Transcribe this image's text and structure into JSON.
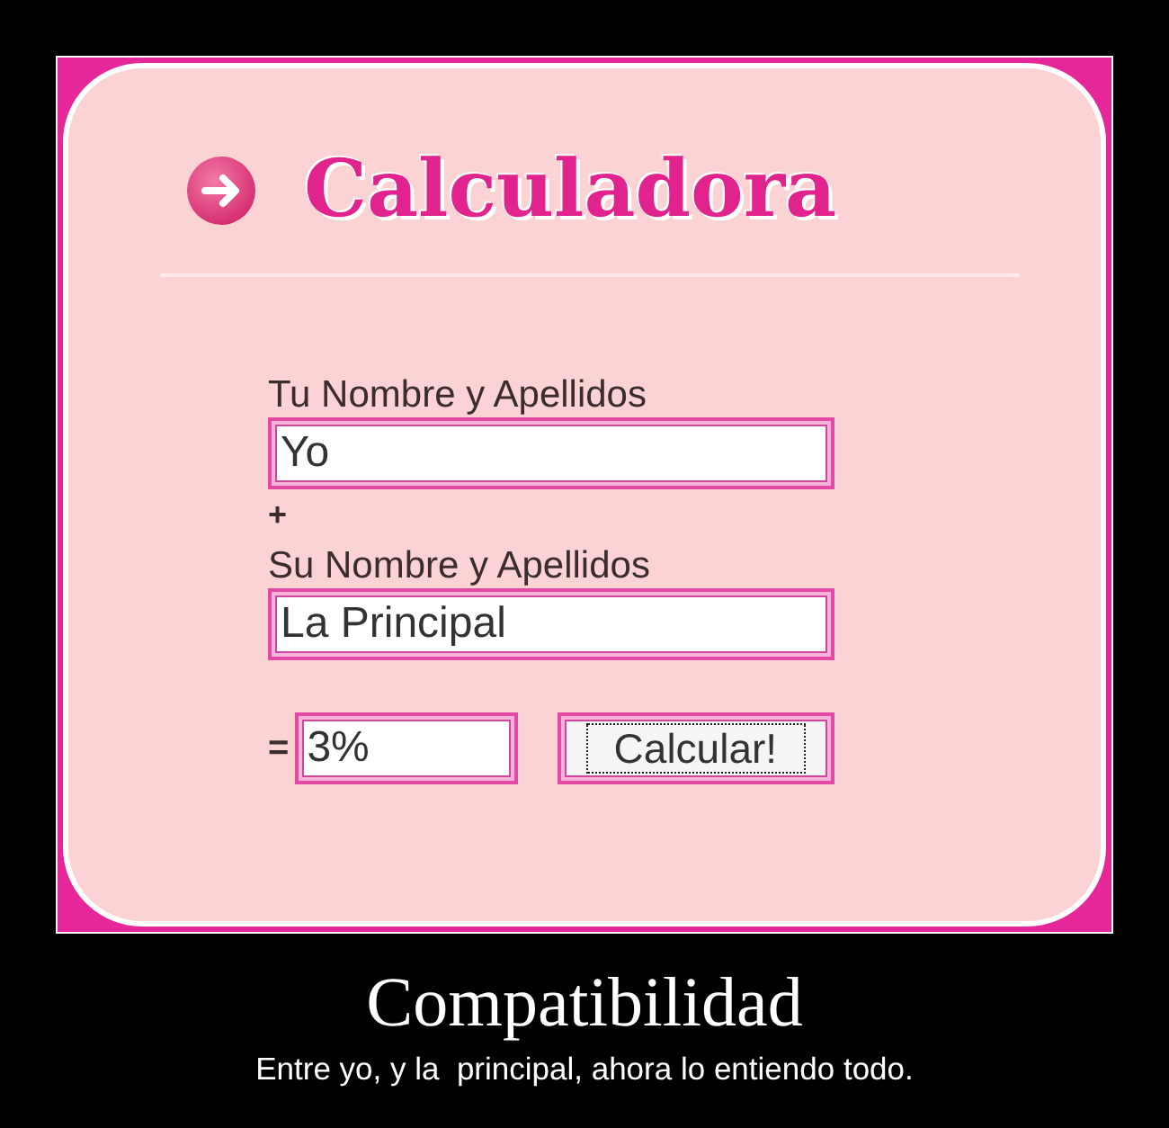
{
  "calculator": {
    "heading": "Calculadora",
    "first_name": {
      "label": "Tu Nombre y Apellidos",
      "value": "Yo"
    },
    "operator": "+",
    "second_name": {
      "label": "Su Nombre y Apellidos",
      "value": "La Principal"
    },
    "equals": "=",
    "result": {
      "value": "3%"
    },
    "button": {
      "label": "Calcular!",
      "focused": true
    }
  },
  "poster": {
    "title": "Compatibilidad",
    "caption": "Entre yo, y la  principal, ahora lo entiendo todo."
  }
}
